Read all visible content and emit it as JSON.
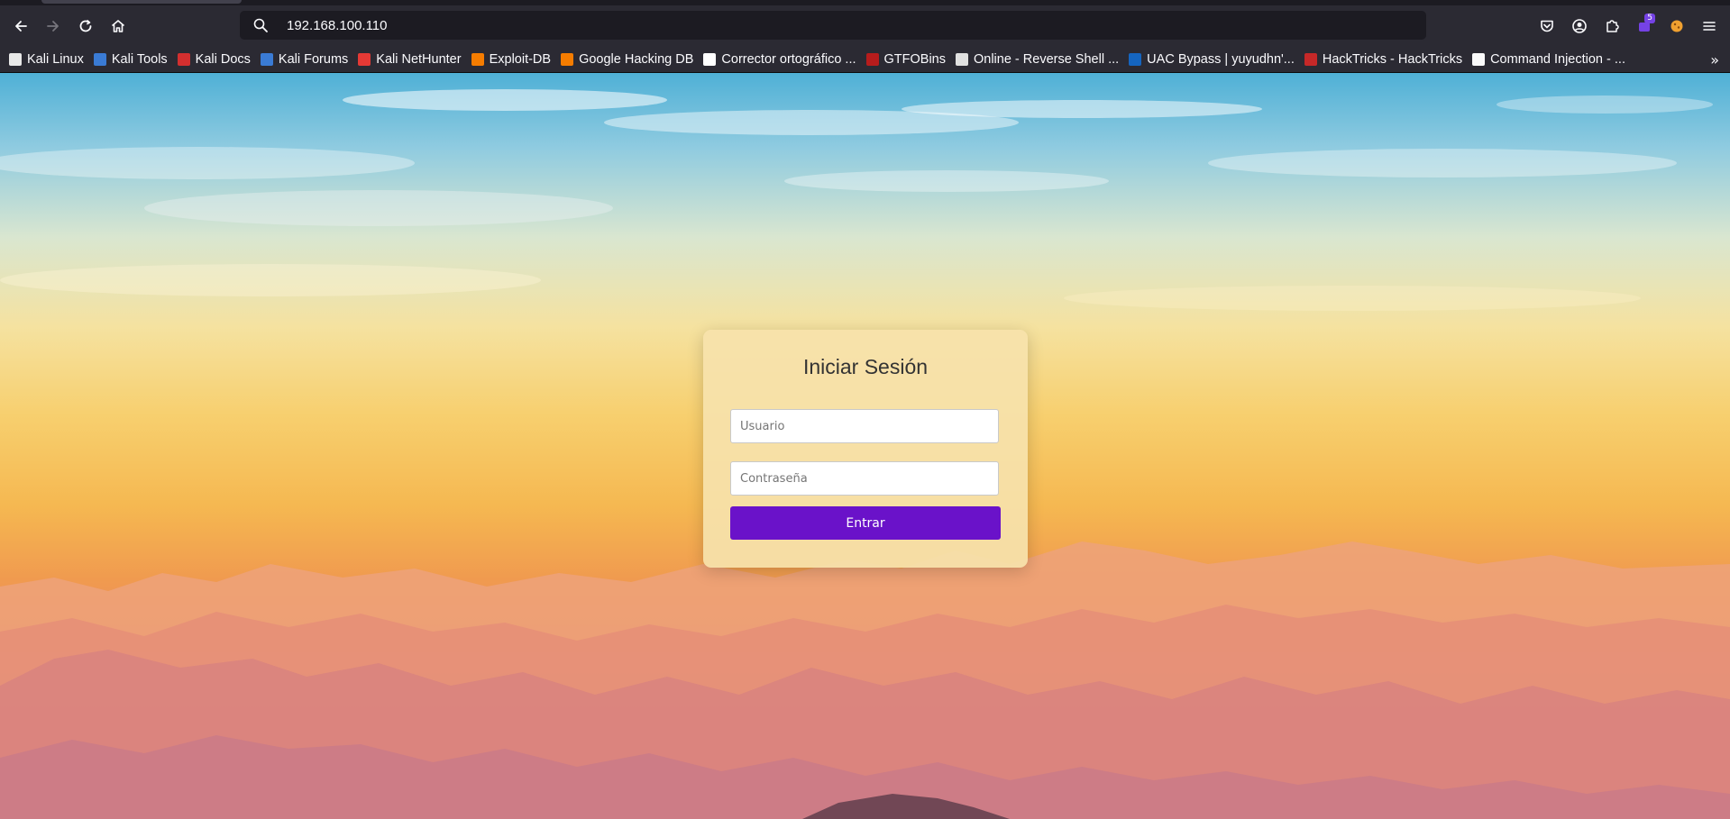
{
  "browser": {
    "url": "192.168.100.110",
    "extensions_badge": "5"
  },
  "bookmarks": [
    {
      "label": "Kali Linux",
      "icon": "kali-dragon-icon",
      "color": "#e8e8e8"
    },
    {
      "label": "Kali Tools",
      "icon": "kali-tools-icon",
      "color": "#3a7bd5"
    },
    {
      "label": "Kali Docs",
      "icon": "kali-docs-icon",
      "color": "#d32f2f"
    },
    {
      "label": "Kali Forums",
      "icon": "kali-forums-icon",
      "color": "#3a7bd5"
    },
    {
      "label": "Kali NetHunter",
      "icon": "nethunter-icon",
      "color": "#e53935"
    },
    {
      "label": "Exploit-DB",
      "icon": "exploit-db-icon",
      "color": "#f57c00"
    },
    {
      "label": "Google Hacking DB",
      "icon": "ghdb-icon",
      "color": "#f57c00"
    },
    {
      "label": "Corrector ortográfico ...",
      "icon": "corrector-icon",
      "color": "#ffffff"
    },
    {
      "label": "GTFOBins",
      "icon": "gtfobins-icon",
      "color": "#b71c1c"
    },
    {
      "label": "Online - Reverse Shell ...",
      "icon": "skull-icon",
      "color": "#e0e0e0"
    },
    {
      "label": "UAC Bypass | yuyudhn'...",
      "icon": "uac-bypass-icon",
      "color": "#1565c0"
    },
    {
      "label": "HackTricks - HackTricks",
      "icon": "hacktricks-icon",
      "color": "#c62828"
    },
    {
      "label": "Command Injection - ...",
      "icon": "command-injection-icon",
      "color": "#fafafa"
    }
  ],
  "login": {
    "title": "Iniciar Sesión",
    "username_placeholder": "Usuario",
    "password_placeholder": "Contraseña",
    "submit_label": "Entrar",
    "accent_color": "#6a12c9"
  }
}
